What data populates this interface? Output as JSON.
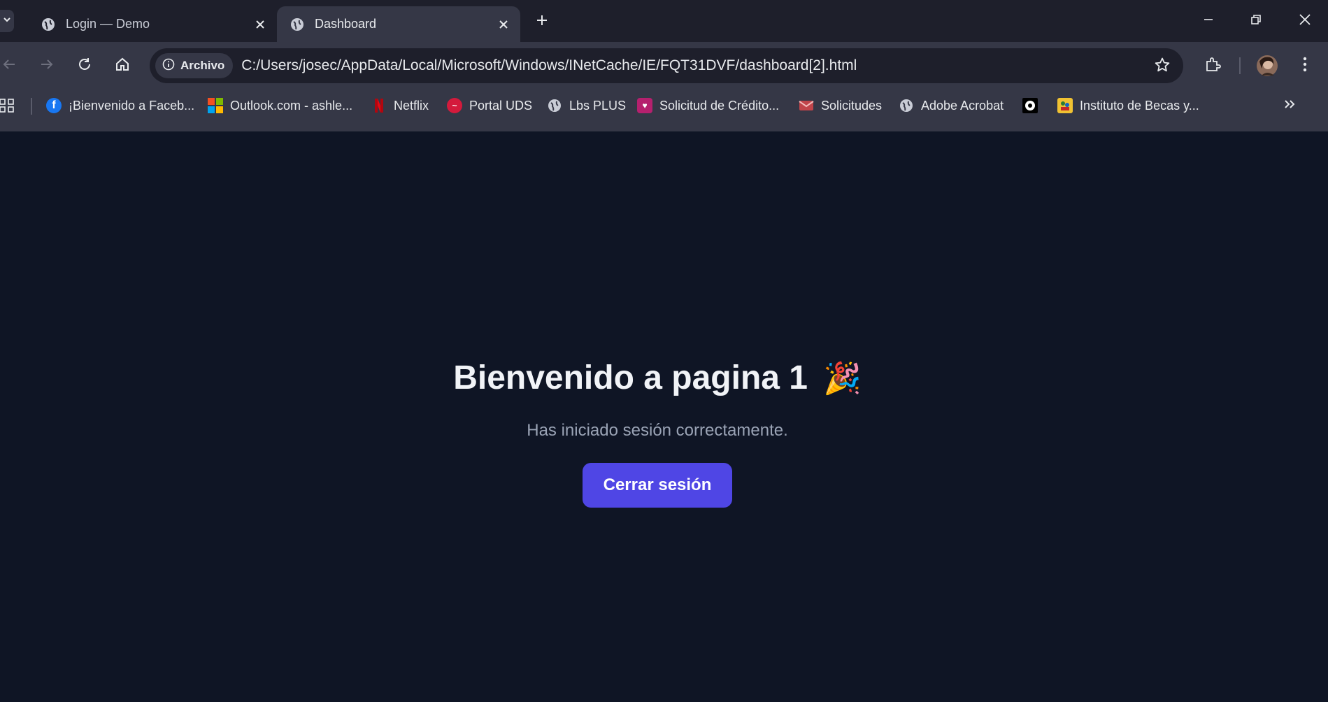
{
  "tabs": [
    {
      "title": "Login — Demo",
      "active": false
    },
    {
      "title": "Dashboard",
      "active": true
    }
  ],
  "omnibox": {
    "chip_label": "Archivo",
    "url": "C:/Users/josec/AppData/Local/Microsoft/Windows/INetCache/IE/FQT31DVF/dashboard[2].html"
  },
  "bookmarks": [
    {
      "label": "¡Bienvenido a Faceb...",
      "icon": "facebook-icon"
    },
    {
      "label": "Outlook.com - ashle...",
      "icon": "microsoft-icon"
    },
    {
      "label": "Netflix",
      "icon": "netflix-icon"
    },
    {
      "label": "Portal UDS",
      "icon": "uds-icon"
    },
    {
      "label": "Lbs PLUS",
      "icon": "globe-icon"
    },
    {
      "label": "Solicitud de Crédito...",
      "icon": "credit-icon"
    },
    {
      "label": "Solicitudes",
      "icon": "mail-icon"
    },
    {
      "label": "Adobe Acrobat",
      "icon": "globe-icon"
    },
    {
      "label": "",
      "icon": "circle-icon"
    },
    {
      "label": "Instituto de Becas y...",
      "icon": "becas-icon"
    }
  ],
  "page": {
    "heading": "Bienvenido a pagina 1",
    "heading_emoji": "🎉",
    "subtitle": "Has iniciado sesión correctamente.",
    "logout_label": "Cerrar sesión"
  },
  "colors": {
    "background": "#0f1525",
    "button": "#4f46e5",
    "tabstrip": "#1e1f2b",
    "toolbar": "#353746"
  }
}
